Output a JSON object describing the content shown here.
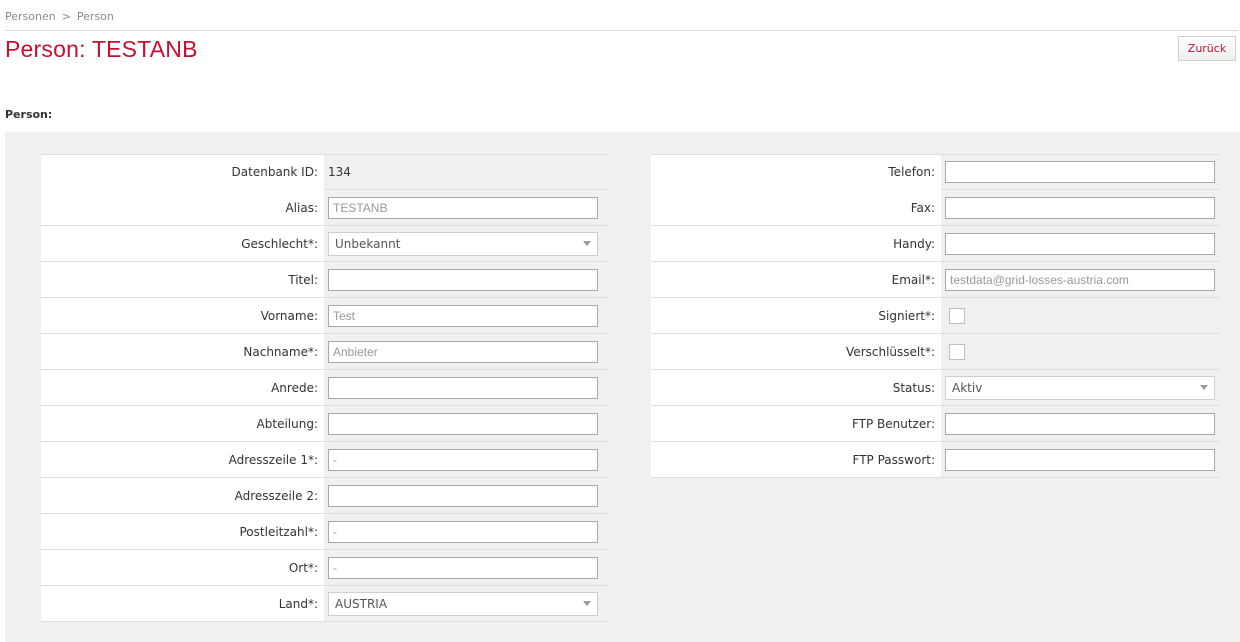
{
  "breadcrumb": {
    "parent": "Personen",
    "separator": ">",
    "current": "Person"
  },
  "page": {
    "title": "Person: TESTANB",
    "back_label": "Zurück",
    "section_title": "Person:"
  },
  "form": {
    "left": {
      "db_id_label": "Datenbank ID:",
      "db_id_value": "134",
      "alias_label": "Alias:",
      "alias_value": "TESTANB",
      "gender_label": "Geschlecht*:",
      "gender_value": "Unbekannt",
      "title_label": "Titel:",
      "title_value": "",
      "firstname_label": "Vorname:",
      "firstname_value": "Test",
      "lastname_label": "Nachname*:",
      "lastname_value": "Anbieter",
      "salutation_label": "Anrede:",
      "salutation_value": "",
      "department_label": "Abteilung:",
      "department_value": "",
      "address1_label": "Adresszeile 1*:",
      "address1_value": "-",
      "address2_label": "Adresszeile 2:",
      "address2_value": "",
      "zip_label": "Postleitzahl*:",
      "zip_value": "-",
      "city_label": "Ort*:",
      "city_value": "-",
      "country_label": "Land*:",
      "country_value": "AUSTRIA"
    },
    "right": {
      "phone_label": "Telefon:",
      "phone_value": "",
      "fax_label": "Fax:",
      "fax_value": "",
      "mobile_label": "Handy:",
      "mobile_value": "",
      "email_label": "Email*:",
      "email_value": "testdata@grid-losses-austria.com",
      "signed_label": "Signiert*:",
      "encrypted_label": "Verschlüsselt*:",
      "status_label": "Status:",
      "status_value": "Aktiv",
      "ftp_user_label": "FTP Benutzer:",
      "ftp_user_value": "",
      "ftp_password_label": "FTP Passwort:",
      "ftp_password_value": ""
    }
  },
  "colors": {
    "accent": "#c8102e",
    "panel": "#f0f0f0"
  }
}
